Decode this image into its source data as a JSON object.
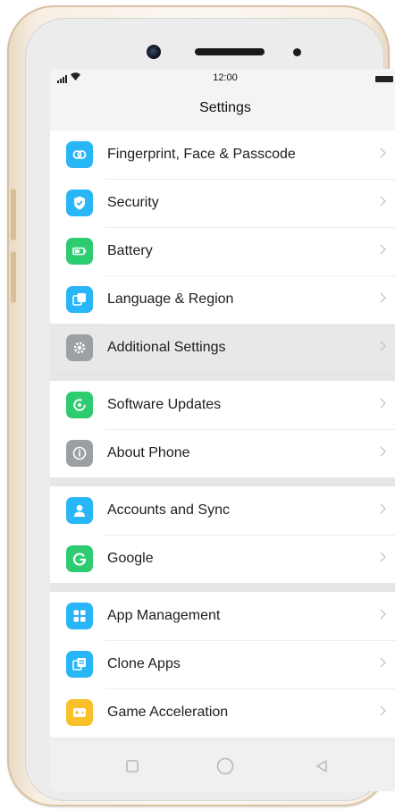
{
  "status_bar": {
    "time": "12:00"
  },
  "header": {
    "title": "Settings"
  },
  "groups": [
    {
      "items": [
        {
          "label": "Fingerprint, Face & Passcode",
          "icon": "fingerprint-icon",
          "color": "#29b6f6",
          "highlighted": false
        },
        {
          "label": "Security",
          "icon": "shield-icon",
          "color": "#29b6f6",
          "highlighted": false
        },
        {
          "label": "Battery",
          "icon": "battery-icon",
          "color": "#2ecc71",
          "highlighted": false
        },
        {
          "label": "Language & Region",
          "icon": "language-icon",
          "color": "#29b6f6",
          "highlighted": false
        },
        {
          "label": "Additional Settings",
          "icon": "gear-icon",
          "color": "#9aa0a6",
          "highlighted": true
        }
      ]
    },
    {
      "items": [
        {
          "label": "Software Updates",
          "icon": "update-icon",
          "color": "#2ecc71",
          "highlighted": false
        },
        {
          "label": "About Phone",
          "icon": "info-icon",
          "color": "#9aa0a6",
          "highlighted": false
        }
      ]
    },
    {
      "items": [
        {
          "label": "Accounts and Sync",
          "icon": "user-icon",
          "color": "#29b6f6",
          "highlighted": false
        },
        {
          "label": "Google",
          "icon": "google-icon",
          "color": "#2ecc71",
          "highlighted": false
        }
      ]
    },
    {
      "items": [
        {
          "label": "App Management",
          "icon": "apps-grid-icon",
          "color": "#29b6f6",
          "highlighted": false
        },
        {
          "label": "Clone Apps",
          "icon": "clone-icon",
          "color": "#29b6f6",
          "highlighted": false
        },
        {
          "label": "Game Acceleration",
          "icon": "game-icon",
          "color": "#f9c02a",
          "highlighted": false
        }
      ]
    }
  ],
  "nav_bar": {
    "recent": "square-icon",
    "home": "circle-icon",
    "back": "triangle-back-icon"
  }
}
